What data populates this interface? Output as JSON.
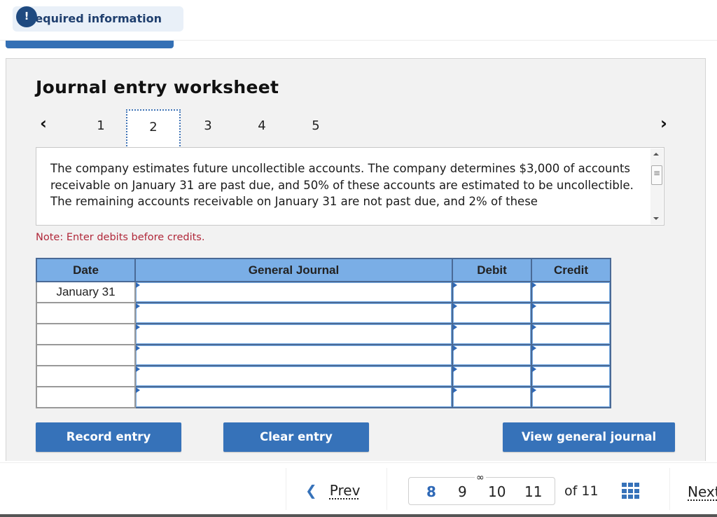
{
  "header": {
    "required_icon": "exclamation-icon",
    "required_label": "Required information"
  },
  "worksheet": {
    "title": "Journal entry worksheet",
    "prev_icon": "chevron-left-icon",
    "next_icon": "chevron-right-icon",
    "steps": [
      "1",
      "2",
      "3",
      "4",
      "5"
    ],
    "active_step": "2",
    "description": "The company estimates future uncollectible accounts. The company determines $3,000 of accounts receivable on January 31 are past due, and 50% of these accounts are estimated to be uncollectible. The remaining accounts receivable on January 31 are not past due, and 2% of these",
    "note": "Note: Enter debits before credits."
  },
  "journal_table": {
    "headers": {
      "date": "Date",
      "general_journal": "General Journal",
      "debit": "Debit",
      "credit": "Credit"
    },
    "rows": [
      {
        "date": "January 31",
        "account": "",
        "debit": "",
        "credit": ""
      },
      {
        "date": "",
        "account": "",
        "debit": "",
        "credit": ""
      },
      {
        "date": "",
        "account": "",
        "debit": "",
        "credit": ""
      },
      {
        "date": "",
        "account": "",
        "debit": "",
        "credit": ""
      },
      {
        "date": "",
        "account": "",
        "debit": "",
        "credit": ""
      },
      {
        "date": "",
        "account": "",
        "debit": "",
        "credit": ""
      }
    ]
  },
  "buttons": {
    "record_entry": "Record entry",
    "clear_entry": "Clear entry",
    "view_general_journal": "View general journal"
  },
  "footer": {
    "prev_label": "Prev",
    "next_label": "Next",
    "pages": [
      "8",
      "9",
      "10",
      "11"
    ],
    "current_page": "8",
    "of_label": "of 11",
    "link_icon": "link-icon",
    "grid_icon": "grid-icon"
  },
  "colors": {
    "accent": "#3672b9",
    "table_header": "#7aaee6",
    "note_red": "#b0283a",
    "badge_bg": "#e9f0f8"
  }
}
